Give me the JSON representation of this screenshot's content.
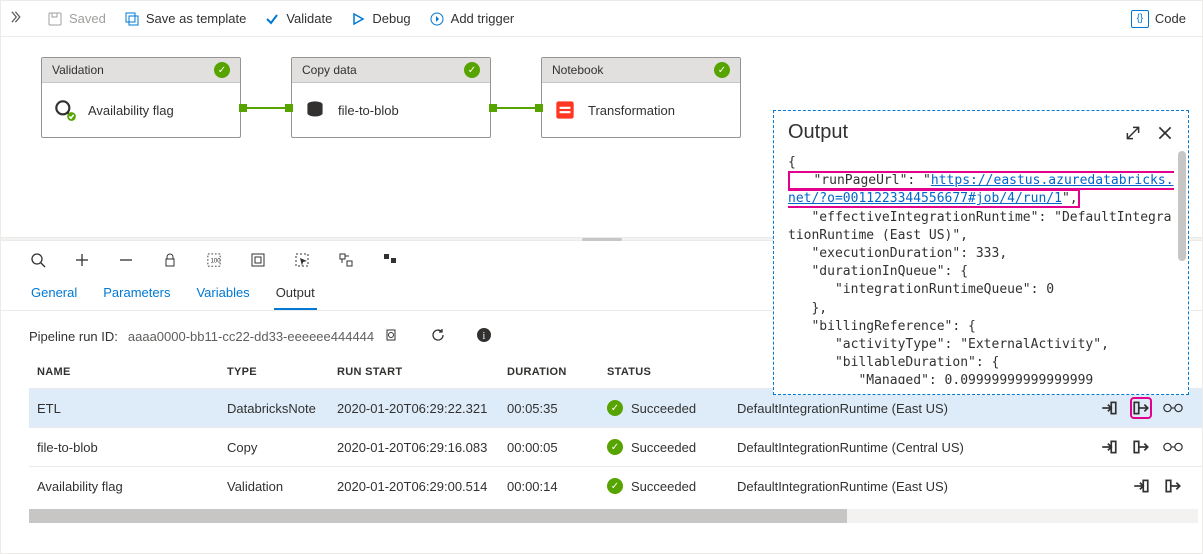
{
  "toolbar": {
    "saved": "Saved",
    "saveTemplate": "Save as template",
    "validate": "Validate",
    "debug": "Debug",
    "addTrigger": "Add trigger",
    "code": "Code"
  },
  "nodes": [
    {
      "type": "Validation",
      "name": "Availability flag",
      "status": "ok"
    },
    {
      "type": "Copy data",
      "name": "file-to-blob",
      "status": "ok"
    },
    {
      "type": "Notebook",
      "name": "Transformation",
      "status": "ok"
    }
  ],
  "tabs": {
    "general": "General",
    "parameters": "Parameters",
    "variables": "Variables",
    "output": "Output"
  },
  "runId": {
    "label": "Pipeline run ID:",
    "value": "aaaa0000-bb11-cc22-dd33-eeeeee444444"
  },
  "table": {
    "headers": {
      "name": "NAME",
      "type": "TYPE",
      "runStart": "RUN START",
      "duration": "DURATION",
      "status": "STATUS",
      "runtime": ""
    },
    "rows": [
      {
        "name": "ETL",
        "type": "DatabricksNote",
        "runStart": "2020-01-20T06:29:22.321",
        "duration": "00:05:35",
        "status": "Succeeded",
        "runtime": "DefaultIntegrationRuntime (East US)",
        "hasGlasses": true,
        "highlightOut": true,
        "selected": true
      },
      {
        "name": "file-to-blob",
        "type": "Copy",
        "runStart": "2020-01-20T06:29:16.083",
        "duration": "00:00:05",
        "status": "Succeeded",
        "runtime": "DefaultIntegrationRuntime (Central US)",
        "hasGlasses": true,
        "highlightOut": false,
        "selected": false
      },
      {
        "name": "Availability flag",
        "type": "Validation",
        "runStart": "2020-01-20T06:29:00.514",
        "duration": "00:00:14",
        "status": "Succeeded",
        "runtime": "DefaultIntegrationRuntime (East US)",
        "hasGlasses": false,
        "highlightOut": false,
        "selected": false
      }
    ]
  },
  "outputPanel": {
    "title": "Output",
    "json": {
      "open": "{",
      "runPageKey": "   \"runPageUrl\": \"",
      "runPageUrl": "https://eastus.azuredatabricks.net/?o=0011223344556677#job/4/run/1",
      "runPageClose": "\",",
      "rest": "   \"effectiveIntegrationRuntime\": \"DefaultIntegrationRuntime (East US)\",\n   \"executionDuration\": 333,\n   \"durationInQueue\": {\n      \"integrationRuntimeQueue\": 0\n   },\n   \"billingReference\": {\n      \"activityType\": \"ExternalActivity\",\n      \"billableDuration\": {\n         \"Managed\": 0.09999999999999999"
    }
  }
}
